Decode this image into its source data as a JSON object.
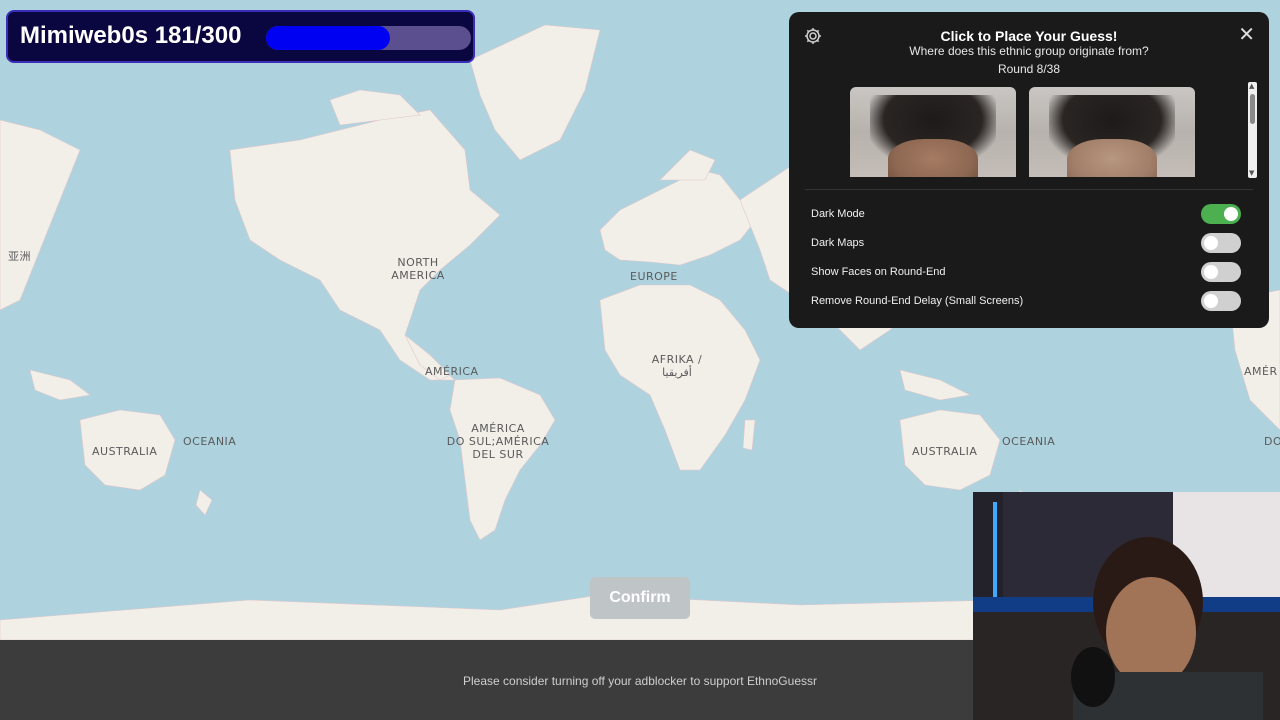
{
  "badge": {
    "title": "Mimiweb0s 181/300",
    "progress_fraction": 0.603,
    "fill_color": "#0000f2",
    "track_color": "#5b4f8f"
  },
  "panel": {
    "settings_icon": "gear-icon",
    "close_label": "✕",
    "title": "Click to Place Your Guess!",
    "question": "Where does this ethnic group originate from?",
    "round": "Round 8/38",
    "settings": [
      {
        "label": "Dark Mode",
        "on": true
      },
      {
        "label": "Dark Maps",
        "on": false
      },
      {
        "label": "Show Faces on Round-End",
        "on": false
      },
      {
        "label": "Remove Round-End Delay (Small Screens)",
        "on": false
      }
    ]
  },
  "map": {
    "labels": {
      "asia_left": "亚洲",
      "north_america": "NORTH\nAMERICA",
      "europe": "EUROPE",
      "africa": "AFRIKA /\nأفريقيا",
      "america": "AMÉRICA",
      "south_america": "AMÉRICA\nDO SUL;AMÉRICA\nDEL SUR",
      "australia_left": "AUSTRALIA",
      "oceania_left": "OCEANIA",
      "australia_right": "AUSTRALIA",
      "oceania_right": "OCEANIA",
      "america_right": "AMÉR",
      "do_right": "DO"
    }
  },
  "confirm_label": "Confirm",
  "footer": {
    "text": "Please consider turning off your adblocker to support EthnoGuessr"
  },
  "colors": {
    "ocean": "#aed3df",
    "land": "#f2efe9",
    "panel_bg": "#1a1a1a",
    "toggle_on": "#4caf50"
  }
}
